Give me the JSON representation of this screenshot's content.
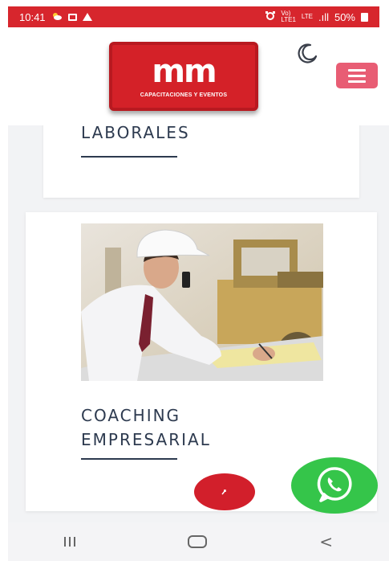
{
  "status_bar": {
    "time": "10:41",
    "network_top": "Vo)",
    "network_bottom": "LTE1",
    "lte": "LTE",
    "signal": ".ıll",
    "battery": "50%"
  },
  "header": {
    "logo_mark": "mm",
    "logo_subtitle": "CAPACITACIONES Y EVENTOS",
    "theme_toggle_icon": "moon-icon",
    "menu_icon": "hamburger-icon"
  },
  "cards": [
    {
      "title_lines": [
        "LABORALES"
      ]
    },
    {
      "title_lines": [
        "COACHING",
        "EMPRESARIAL"
      ],
      "image": "businessman-on-phone-construction-site"
    }
  ],
  "floating": {
    "scroll_top_icon": "arrow-up-icon",
    "whatsapp_icon": "whatsapp-icon"
  },
  "colors": {
    "brand_red": "#d42128",
    "menu_pink": "#e85d74",
    "title_navy": "#2d3a4f",
    "whatsapp_green": "#35c54a"
  }
}
